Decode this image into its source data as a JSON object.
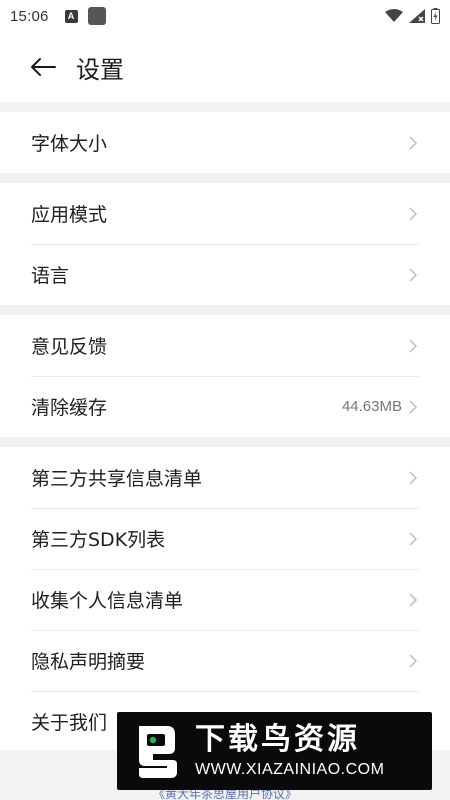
{
  "status_bar": {
    "time": "15:06",
    "icons": [
      "notification-a-icon",
      "app-square-icon",
      "wifi-icon",
      "signal-icon",
      "battery-icon"
    ]
  },
  "header": {
    "title": "设置",
    "back_icon": "arrow-left-icon"
  },
  "groups": [
    {
      "items": [
        {
          "label": "字体大小",
          "value": ""
        }
      ]
    },
    {
      "items": [
        {
          "label": "应用模式",
          "value": ""
        },
        {
          "label": "语言",
          "value": ""
        }
      ]
    },
    {
      "items": [
        {
          "label": "意见反馈",
          "value": ""
        },
        {
          "label": "清除缓存",
          "value": "44.63MB"
        }
      ]
    },
    {
      "items": [
        {
          "label": "第三方共享信息清单",
          "value": ""
        },
        {
          "label": "第三方SDK列表",
          "value": ""
        },
        {
          "label": "收集个人信息清单",
          "value": ""
        },
        {
          "label": "隐私声明摘要",
          "value": ""
        },
        {
          "label": "关于我们",
          "value": ""
        }
      ]
    }
  ],
  "footer": {
    "link_text": "《黄大年茶思屋用户协议》"
  },
  "watermark": {
    "title": "下载鸟资源",
    "url": "WWW.XIAZAINIAO.COM"
  },
  "colors": {
    "background": "#ffffff",
    "separator": "#f2f2f2",
    "link": "#5b6fb5"
  }
}
